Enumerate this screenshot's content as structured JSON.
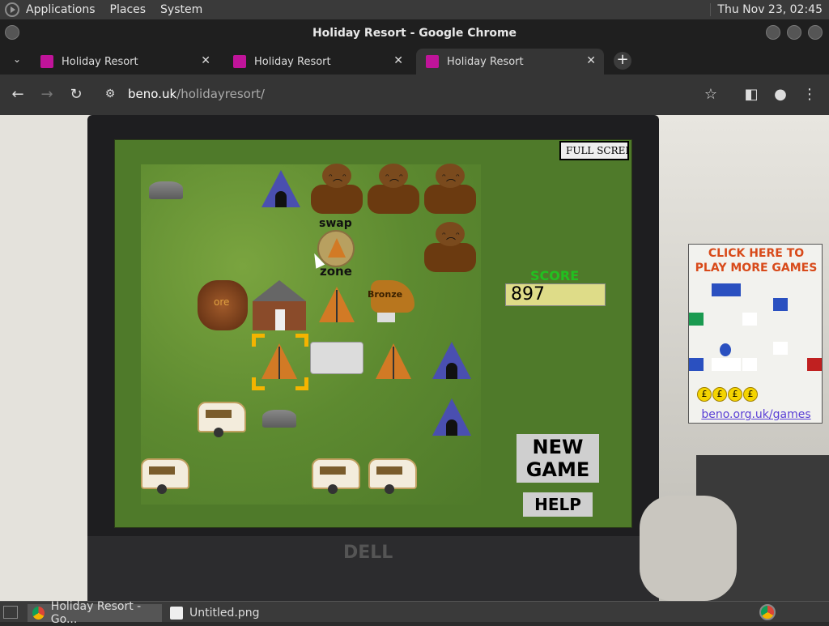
{
  "os_panel": {
    "menus": [
      "Applications",
      "Places",
      "System"
    ],
    "clock": "Thu Nov 23, 02:45"
  },
  "window": {
    "title": "Holiday Resort - Google Chrome"
  },
  "tabs": [
    {
      "label": "Holiday Resort"
    },
    {
      "label": "Holiday Resort"
    },
    {
      "label": "Holiday Resort"
    }
  ],
  "toolbar": {
    "url_host": "beno.uk",
    "url_path": "/holidayresort/"
  },
  "game": {
    "fullscreen_label": "FULL SCREEN",
    "swap_label": "swap",
    "zone_label": "zone",
    "ore_label": "ore",
    "bronze_label": "Bronze",
    "score_title": "SCORE",
    "score_value": "897",
    "new_game_line1": "NEW",
    "new_game_line2": "GAME",
    "help_label": "HELP",
    "pieces": [
      {
        "type": "rock"
      },
      {
        "type": "tent-blue"
      },
      {
        "type": "bear"
      },
      {
        "type": "bear"
      },
      {
        "type": "bear"
      },
      {
        "type": "bear"
      },
      {
        "type": "ore"
      },
      {
        "type": "house"
      },
      {
        "type": "tent-orange"
      },
      {
        "type": "bronze"
      },
      {
        "type": "tent-orange"
      },
      {
        "type": "trailer"
      },
      {
        "type": "tent-orange"
      },
      {
        "type": "tent-blue"
      },
      {
        "type": "caravan"
      },
      {
        "type": "rock"
      },
      {
        "type": "tent-blue"
      },
      {
        "type": "caravan"
      },
      {
        "type": "caravan"
      },
      {
        "type": "caravan"
      }
    ]
  },
  "ad": {
    "line1": "CLICK HERE TO",
    "line2": "PLAY MORE GAMES",
    "link": "beno.org.uk/games",
    "coin_symbol": "£"
  },
  "taskbar": {
    "tasks": [
      "Holiday Resort - Go...",
      "Untitled.png"
    ]
  }
}
